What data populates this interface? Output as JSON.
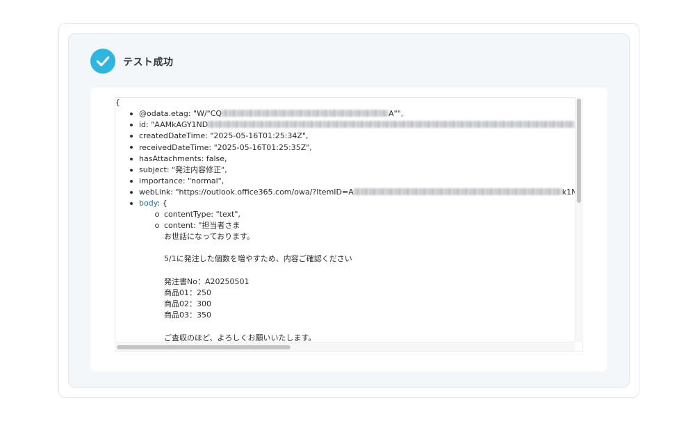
{
  "header": {
    "title": "テスト成功",
    "status_icon": "check-circle-icon",
    "accent_color": "#2fb6e0"
  },
  "json_view": {
    "open_brace": "{",
    "fields": {
      "odata_etag": {
        "prefix": "@odata.etag: \"W/\"CQ",
        "suffix": "A\"\","
      },
      "id": {
        "prefix": "id: \"AAMkAGY1ND",
        "suffix": "nv"
      },
      "createdDateTime": "createdDateTime: \"2025-05-16T01:25:34Z\",",
      "receivedDateTime": "receivedDateTime: \"2025-05-16T01:25:35Z\",",
      "hasAttachments": "hasAttachments: false,",
      "subject": "subject: \"発注内容修正\",",
      "importance": "importance: \"normal\",",
      "webLink": {
        "prefix": "webLink: \"https://outlook.office365.com/owa/?ItemID=A",
        "suffix": "k1N"
      },
      "body_key": "body",
      "body_open": ": {"
    },
    "body": {
      "contentType": "contentType: \"text\",",
      "content_lines": [
        "content: \"担当者さま",
        "お世話になっております。",
        "",
        "5/1に発注した個数を増やすため、内容ご確認ください",
        "",
        "発注書No：A20250501",
        "商品01：250",
        "商品02：300",
        "商品03：350",
        "",
        "ご査収のほど、よろしくお願いいたします。"
      ]
    }
  }
}
